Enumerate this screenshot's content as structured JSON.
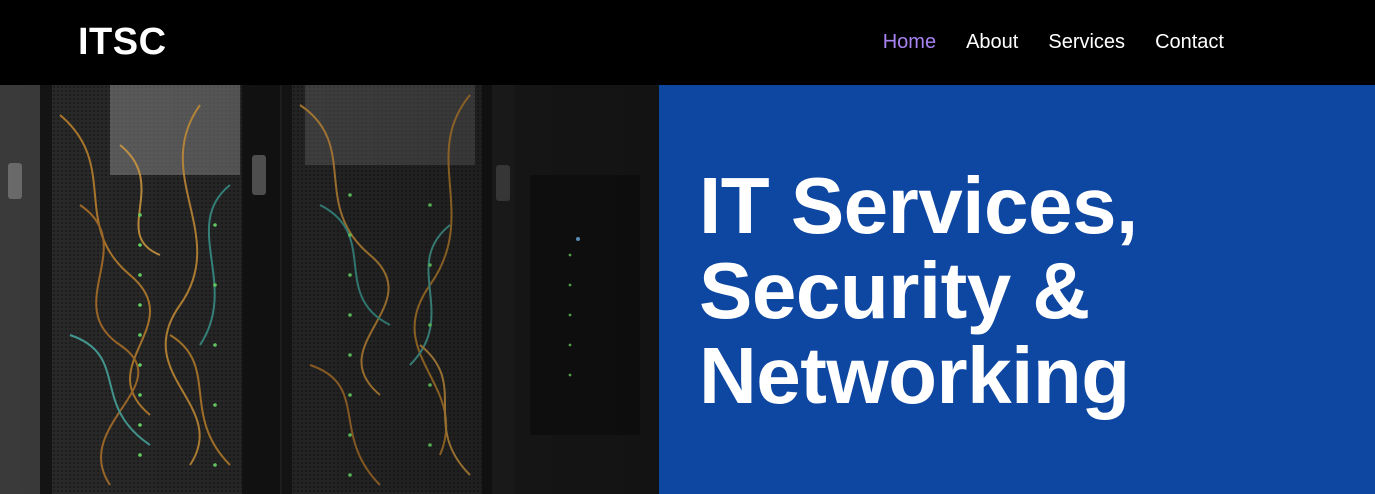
{
  "header": {
    "logo": "ITSC",
    "nav": [
      {
        "label": "Home",
        "active": true
      },
      {
        "label": "About",
        "active": false
      },
      {
        "label": "Services",
        "active": false
      },
      {
        "label": "Contact",
        "active": false
      }
    ]
  },
  "hero": {
    "image_subject": "server-racks-photo",
    "title_lines": [
      "IT Services,",
      "Security &",
      "Networking"
    ]
  },
  "colors": {
    "nav_background": "#000000",
    "nav_active": "#a883f2",
    "hero_panel": "#0e47a1",
    "text": "#ffffff"
  }
}
